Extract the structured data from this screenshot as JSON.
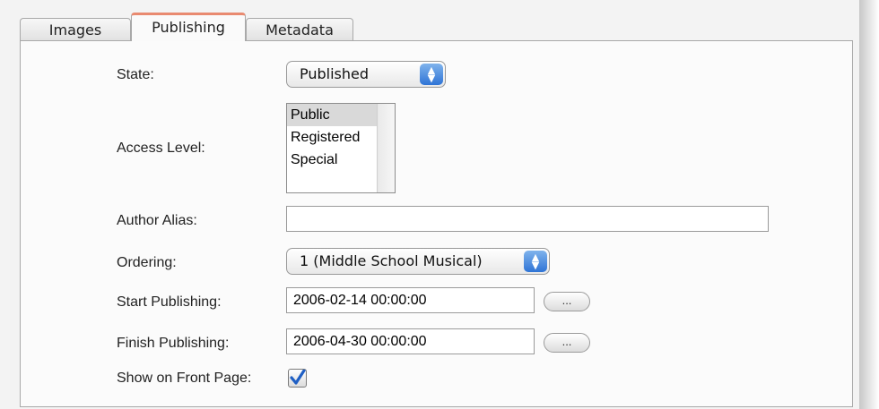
{
  "tabs": [
    {
      "label": "Images",
      "active": false
    },
    {
      "label": "Publishing",
      "active": true
    },
    {
      "label": "Metadata",
      "active": false
    }
  ],
  "form": {
    "state": {
      "label": "State:",
      "value": "Published"
    },
    "access_level": {
      "label": "Access Level:",
      "options": [
        "Public",
        "Registered",
        "Special"
      ],
      "selected": "Public"
    },
    "author_alias": {
      "label": "Author Alias:",
      "value": ""
    },
    "ordering": {
      "label": "Ordering:",
      "value": "1 (Middle School Musical)"
    },
    "start_publishing": {
      "label": "Start Publishing:",
      "value": "2006-02-14 00:00:00",
      "button": "..."
    },
    "finish_publishing": {
      "label": "Finish Publishing:",
      "value": "2006-04-30 00:00:00",
      "button": "..."
    },
    "front_page": {
      "label": "Show on Front Page:",
      "checked": true
    }
  },
  "colors": {
    "active_tab_accent": "#e98a70",
    "select_arrow": "#2f74d6",
    "checkmark": "#1f5fc4"
  },
  "icons": {
    "select_arrows": "up-down-arrows-icon",
    "checkbox": "checkmark-icon"
  }
}
